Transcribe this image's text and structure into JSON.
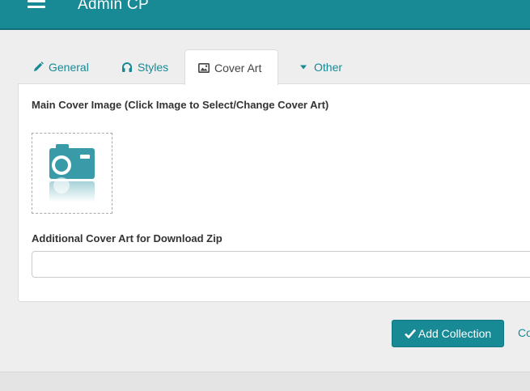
{
  "header": {
    "title": "Admin CP",
    "menu_icon": "hamburger-menu-icon",
    "bg_color": "#178a95"
  },
  "tabs": [
    {
      "label": "General",
      "icon": "pencil-icon",
      "active": false
    },
    {
      "label": "Styles",
      "icon": "headphones-icon",
      "active": false
    },
    {
      "label": "Cover Art",
      "icon": "image-icon",
      "active": true
    },
    {
      "label": "Other",
      "icon": "caret-down-icon",
      "active": false
    }
  ],
  "cover_art": {
    "main_label": "Main Cover Image (Click Image to Select/Change Cover Art)",
    "placeholder_icon": "camera-icon",
    "additional_label": "Additional Cover Art for Download Zip",
    "additional_value": ""
  },
  "actions": {
    "add_label": "Add Collection",
    "add_icon": "checkmark-icon",
    "cancel_label": "Co"
  },
  "colors": {
    "accent": "#178a95",
    "camera": "#3a9ba8"
  }
}
